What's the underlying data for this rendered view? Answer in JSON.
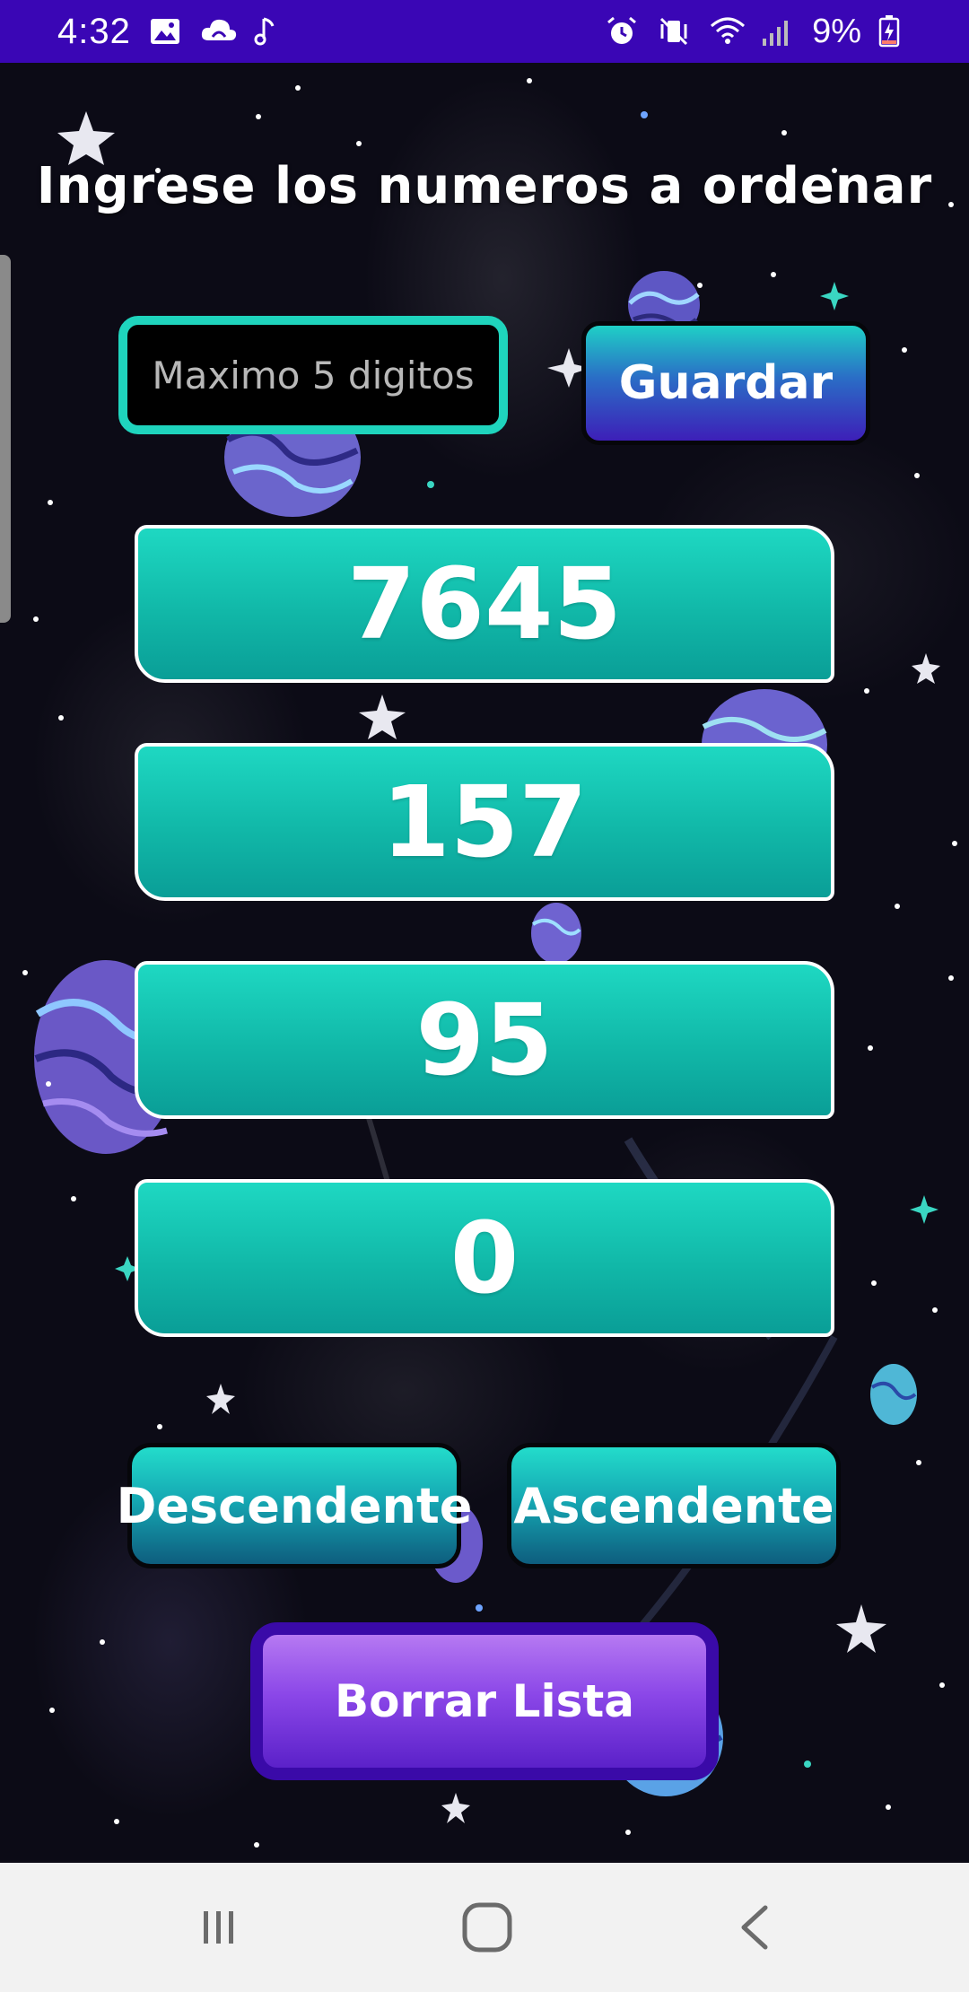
{
  "status_bar": {
    "time": "4:32",
    "left_icons": [
      "image-icon",
      "cloud-sync-icon",
      "music-note-icon"
    ],
    "right_icons": [
      "alarm-icon",
      "mute-vibrate-icon",
      "wifi-icon",
      "signal-icon",
      "battery-charging-icon"
    ],
    "battery_text": "9%"
  },
  "main": {
    "title": "Ingrese los numeros a ordenar",
    "input": {
      "placeholder": "Maximo 5 digitos",
      "value": ""
    },
    "save_label": "Guardar",
    "numbers": [
      "7645",
      "157",
      "95",
      "0"
    ],
    "descending_label": "Descendente",
    "ascending_label": "Ascendente",
    "clear_label": "Borrar Lista"
  },
  "nav_bar": {
    "buttons": [
      "recent-apps",
      "home",
      "back"
    ]
  },
  "colors": {
    "status_bar": "#3a06b5",
    "accent_teal": "#1fd4bd",
    "background": "#0c0b16",
    "clear_button": "#8b47e8"
  }
}
